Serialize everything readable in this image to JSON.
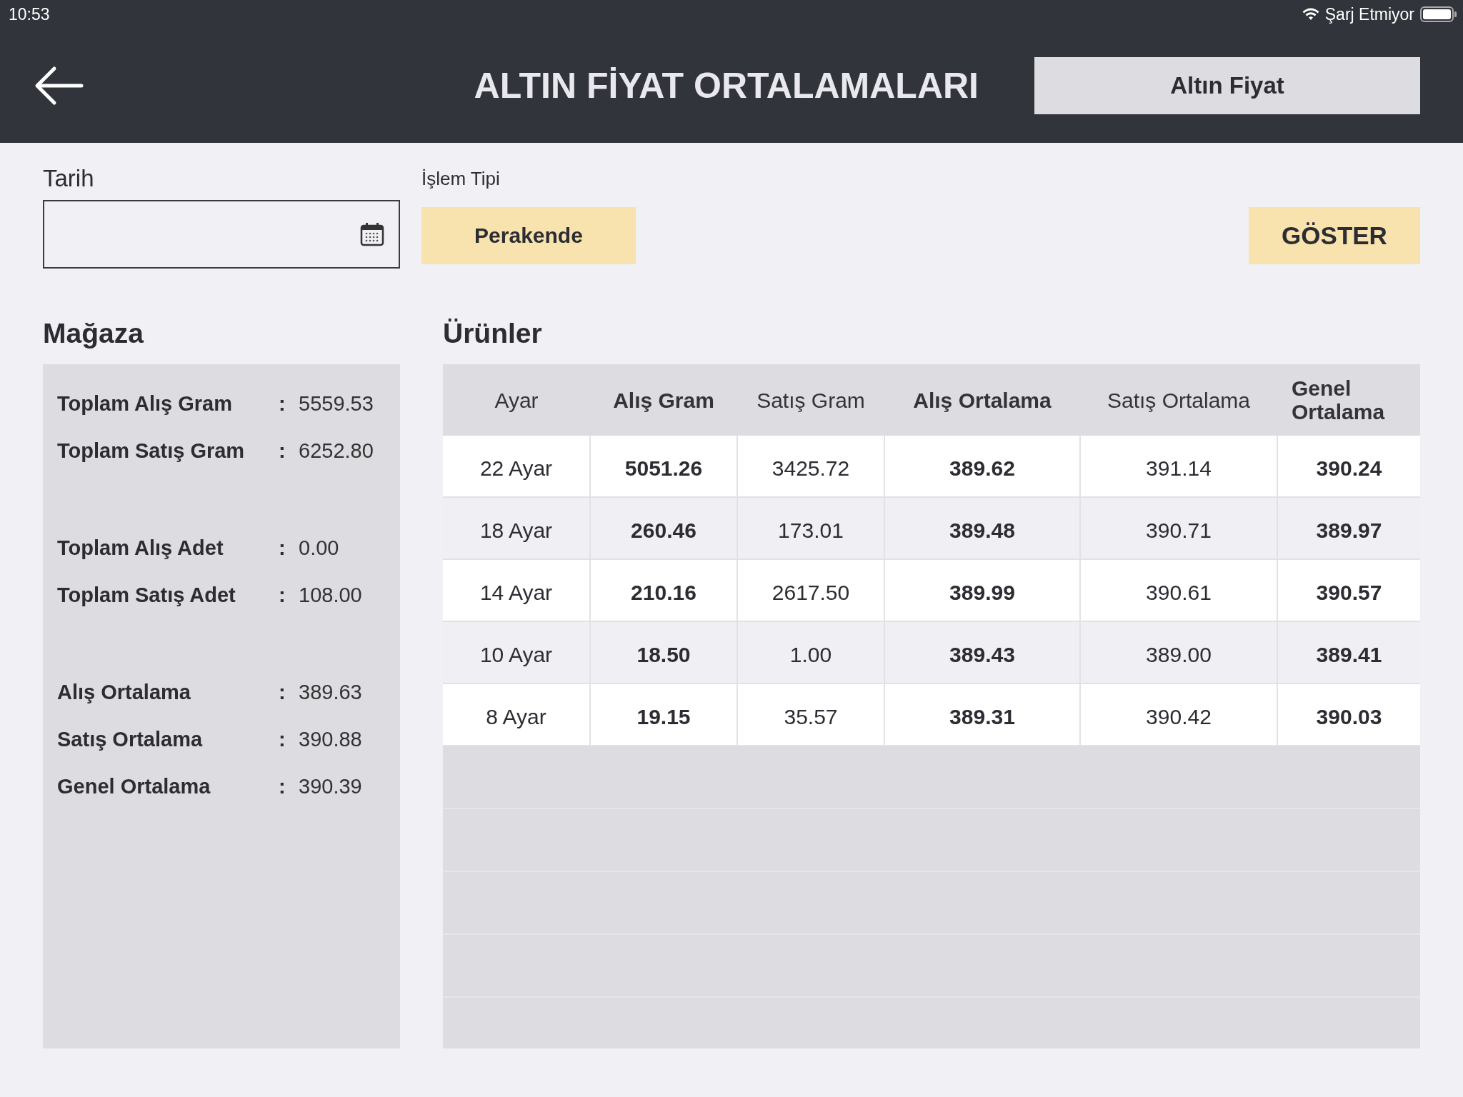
{
  "status_bar": {
    "time": "10:53",
    "charging": "Şarj Etmiyor"
  },
  "header": {
    "title": "ALTIN FİYAT ORTALAMALARI",
    "button": "Altın Fiyat"
  },
  "filters": {
    "date_label": "Tarih",
    "type_label": "İşlem Tipi",
    "type_button": "Perakende",
    "show_button": "GÖSTER"
  },
  "store": {
    "title": "Mağaza",
    "groups": [
      [
        {
          "label": "Toplam Alış Gram",
          "separator": ":",
          "value": "5559.53"
        },
        {
          "label": "Toplam Satış Gram",
          "separator": ":",
          "value": "6252.80"
        }
      ],
      [
        {
          "label": "Toplam Alış Adet",
          "separator": ":",
          "value": "0.00"
        },
        {
          "label": "Toplam Satış Adet",
          "separator": ":",
          "value": "108.00"
        }
      ],
      [
        {
          "label": "Alış Ortalama",
          "separator": ":",
          "value": "389.63"
        },
        {
          "label": "Satış Ortalama",
          "separator": ":",
          "value": "390.88"
        },
        {
          "label": "Genel Ortalama",
          "separator": ":",
          "value": "390.39"
        }
      ]
    ]
  },
  "products": {
    "title": "Ürünler",
    "columns": [
      {
        "label": "Ayar",
        "bold": false
      },
      {
        "label": "Alış Gram",
        "bold": true
      },
      {
        "label": "Satış Gram",
        "bold": false
      },
      {
        "label": "Alış Ortalama",
        "bold": true
      },
      {
        "label": "Satış Ortalama",
        "bold": false
      },
      {
        "label": "Genel Ortalama",
        "bold": true
      }
    ],
    "rows": [
      [
        "22 Ayar",
        "5051.26",
        "3425.72",
        "389.62",
        "391.14",
        "390.24"
      ],
      [
        "18 Ayar",
        "260.46",
        "173.01",
        "389.48",
        "390.71",
        "389.97"
      ],
      [
        "14 Ayar",
        "210.16",
        "2617.50",
        "389.99",
        "390.61",
        "390.57"
      ],
      [
        "10 Ayar",
        "18.50",
        "1.00",
        "389.43",
        "389.00",
        "389.41"
      ],
      [
        "8 Ayar",
        "19.15",
        "35.57",
        "389.31",
        "390.42",
        "390.03"
      ]
    ]
  }
}
